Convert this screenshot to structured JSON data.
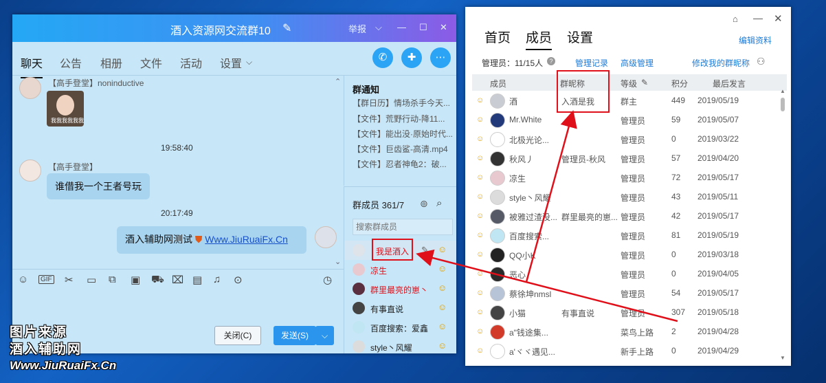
{
  "chat": {
    "title": "酒入资源网交流群10",
    "title_actions": {
      "report": "举报",
      "chevron": "⌵",
      "minimize": "—",
      "maximize": "☐",
      "close": "✕"
    },
    "tabs": [
      "聊天",
      "公告",
      "相册",
      "文件",
      "活动",
      "设置"
    ],
    "active_tab": "聊天",
    "messages": [
      {
        "sender": "【高手登堂】noninductive",
        "type": "image"
      },
      {
        "time": "19:58:40"
      },
      {
        "sender": "【高手登堂】",
        "text": "谁借我一个王者号玩"
      },
      {
        "time": "20:17:49"
      },
      {
        "self": true,
        "text": "酒入辅助网测试",
        "link": "Www.JiuRuaiFx.Cn"
      }
    ],
    "image_caption": "我我我我我我",
    "close_button": "关闭(C)",
    "send_button": "发送(S)",
    "notice": {
      "title": "群通知",
      "items": [
        "【群日历】情场杀手今天...",
        "【文件】荒野行动-降11...",
        "【文件】能出没·原始时代...",
        "【文件】巨齿鲨-高清.mp4",
        "【文件】忍者神龟2：破..."
      ]
    },
    "members": {
      "title": "群成员 361/7",
      "search_placeholder": "搜索群成员",
      "list": [
        {
          "name": "我是酒入",
          "highlight": true,
          "color": "#e0101a"
        },
        {
          "name": "凉生",
          "color": "#e0101a"
        },
        {
          "name": "群里最亮的崽丶",
          "color": "#e0101a"
        },
        {
          "name": "有事直说",
          "color": "#222222"
        },
        {
          "name": "百度搜索：爱鑫",
          "color": "#222222"
        },
        {
          "name": "style丶风耀",
          "color": "#222222"
        }
      ]
    }
  },
  "watermark": {
    "line1": "图片来源",
    "line2": "酒入辅助网",
    "line3": "Www.JiuRuaiFx.Cn"
  },
  "members_window": {
    "tabs": [
      "首页",
      "成员",
      "设置"
    ],
    "active_tab": "成员",
    "edit_profile": "编辑资料",
    "admin_count": "管理员：11/15人",
    "manage_record": "管理记录",
    "advanced_manage": "高级管理",
    "modify_nickname": "修改我的群昵称",
    "columns": [
      "成员",
      "群昵称",
      "等级",
      "积分",
      "最后发言"
    ],
    "rows": [
      {
        "member": "酒",
        "nickname": "入酒是我",
        "level": "群主",
        "points": "449",
        "last": "2019/05/19",
        "avatar": "#c9ccd3"
      },
      {
        "member": "Mr.White",
        "nickname": "",
        "level": "管理员",
        "points": "59",
        "last": "2019/05/07",
        "avatar": "#223a7a"
      },
      {
        "member": "北极光论...",
        "nickname": "",
        "level": "管理员",
        "points": "0",
        "last": "2019/03/22",
        "avatar": "#ffffff"
      },
      {
        "member": "秋风丿",
        "nickname": "管理员-秋风",
        "level": "管理员",
        "points": "57",
        "last": "2019/04/20",
        "avatar": "#333333"
      },
      {
        "member": "凉生",
        "nickname": "",
        "level": "管理员",
        "points": "72",
        "last": "2019/05/17",
        "avatar": "#e8c9d0"
      },
      {
        "member": "style丶风耀",
        "nickname": "",
        "level": "管理员",
        "points": "43",
        "last": "2019/05/11",
        "avatar": "#dcdcdc"
      },
      {
        "member": "被雅过渣没...",
        "nickname": "群里最亮的崽...",
        "level": "管理员",
        "points": "42",
        "last": "2019/05/17",
        "avatar": "#555a66"
      },
      {
        "member": "百度搜索...",
        "nickname": "",
        "level": "管理员",
        "points": "81",
        "last": "2019/05/19",
        "avatar": "#bfe6f2"
      },
      {
        "member": "QQ小K",
        "nickname": "",
        "level": "管理员",
        "points": "0",
        "last": "2019/03/18",
        "avatar": "#222222"
      },
      {
        "member": "恶心",
        "nickname": "",
        "level": "管理员",
        "points": "0",
        "last": "2019/04/05",
        "avatar": "#2a2a2a"
      },
      {
        "member": "蔡徐坤nmsl",
        "nickname": "",
        "level": "管理员",
        "points": "54",
        "last": "2019/05/17",
        "avatar": "#b7c3d6"
      },
      {
        "member": "小猫",
        "nickname": "有事直说",
        "level": "管理员",
        "points": "307",
        "last": "2019/05/18",
        "avatar": "#444444"
      },
      {
        "member": "a\"钱途集...",
        "nickname": "",
        "level": "菜鸟上路",
        "points": "2",
        "last": "2019/04/28",
        "avatar": "#d23a2a"
      },
      {
        "member": "a'ヾヾ遇见...",
        "nickname": "",
        "level": "新手上路",
        "points": "0",
        "last": "2019/04/29",
        "avatar": "#ffffff"
      }
    ]
  },
  "colors": {
    "accent_red": "#e0101a",
    "link_blue": "#1f7bd6",
    "qq_blue": "#2b95ee"
  }
}
